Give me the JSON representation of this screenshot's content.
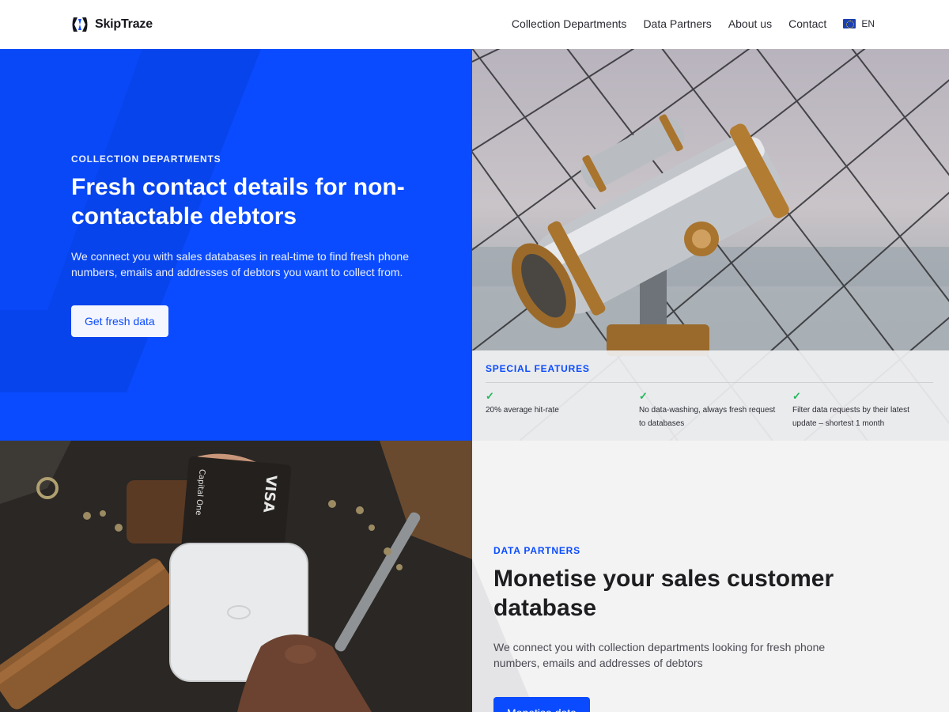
{
  "nav": {
    "brand": "SkipTraze",
    "links": [
      "Collection Departments",
      "Data Partners",
      "About us",
      "Contact"
    ],
    "language": "EN"
  },
  "hero": {
    "eyebrow": "COLLECTION DEPARTMENTS",
    "title": "Fresh contact details for non-contactable debtors",
    "text": "We connect you with sales databases in real-time to find fresh phone numbers, emails and addresses of debtors you want to collect from.",
    "cta": "Get fresh data"
  },
  "features": {
    "eyebrow": "SPECIAL FEATURES",
    "items": [
      "20% average hit-rate",
      "No data-washing, always fresh request to databases",
      "Filter data requests by their latest update – shortest 1 month"
    ]
  },
  "partners": {
    "eyebrow": "DATA PARTNERS",
    "title": "Monetise your sales customer database",
    "text": "We connect you with collection departments looking for fresh phone numbers, emails and addresses of debtors",
    "cta": "Monetise data"
  },
  "photo_card": {
    "brand": "Capital One",
    "network": "VISA"
  },
  "colors": {
    "accent": "#0a4bff",
    "check": "#1fb85a"
  }
}
